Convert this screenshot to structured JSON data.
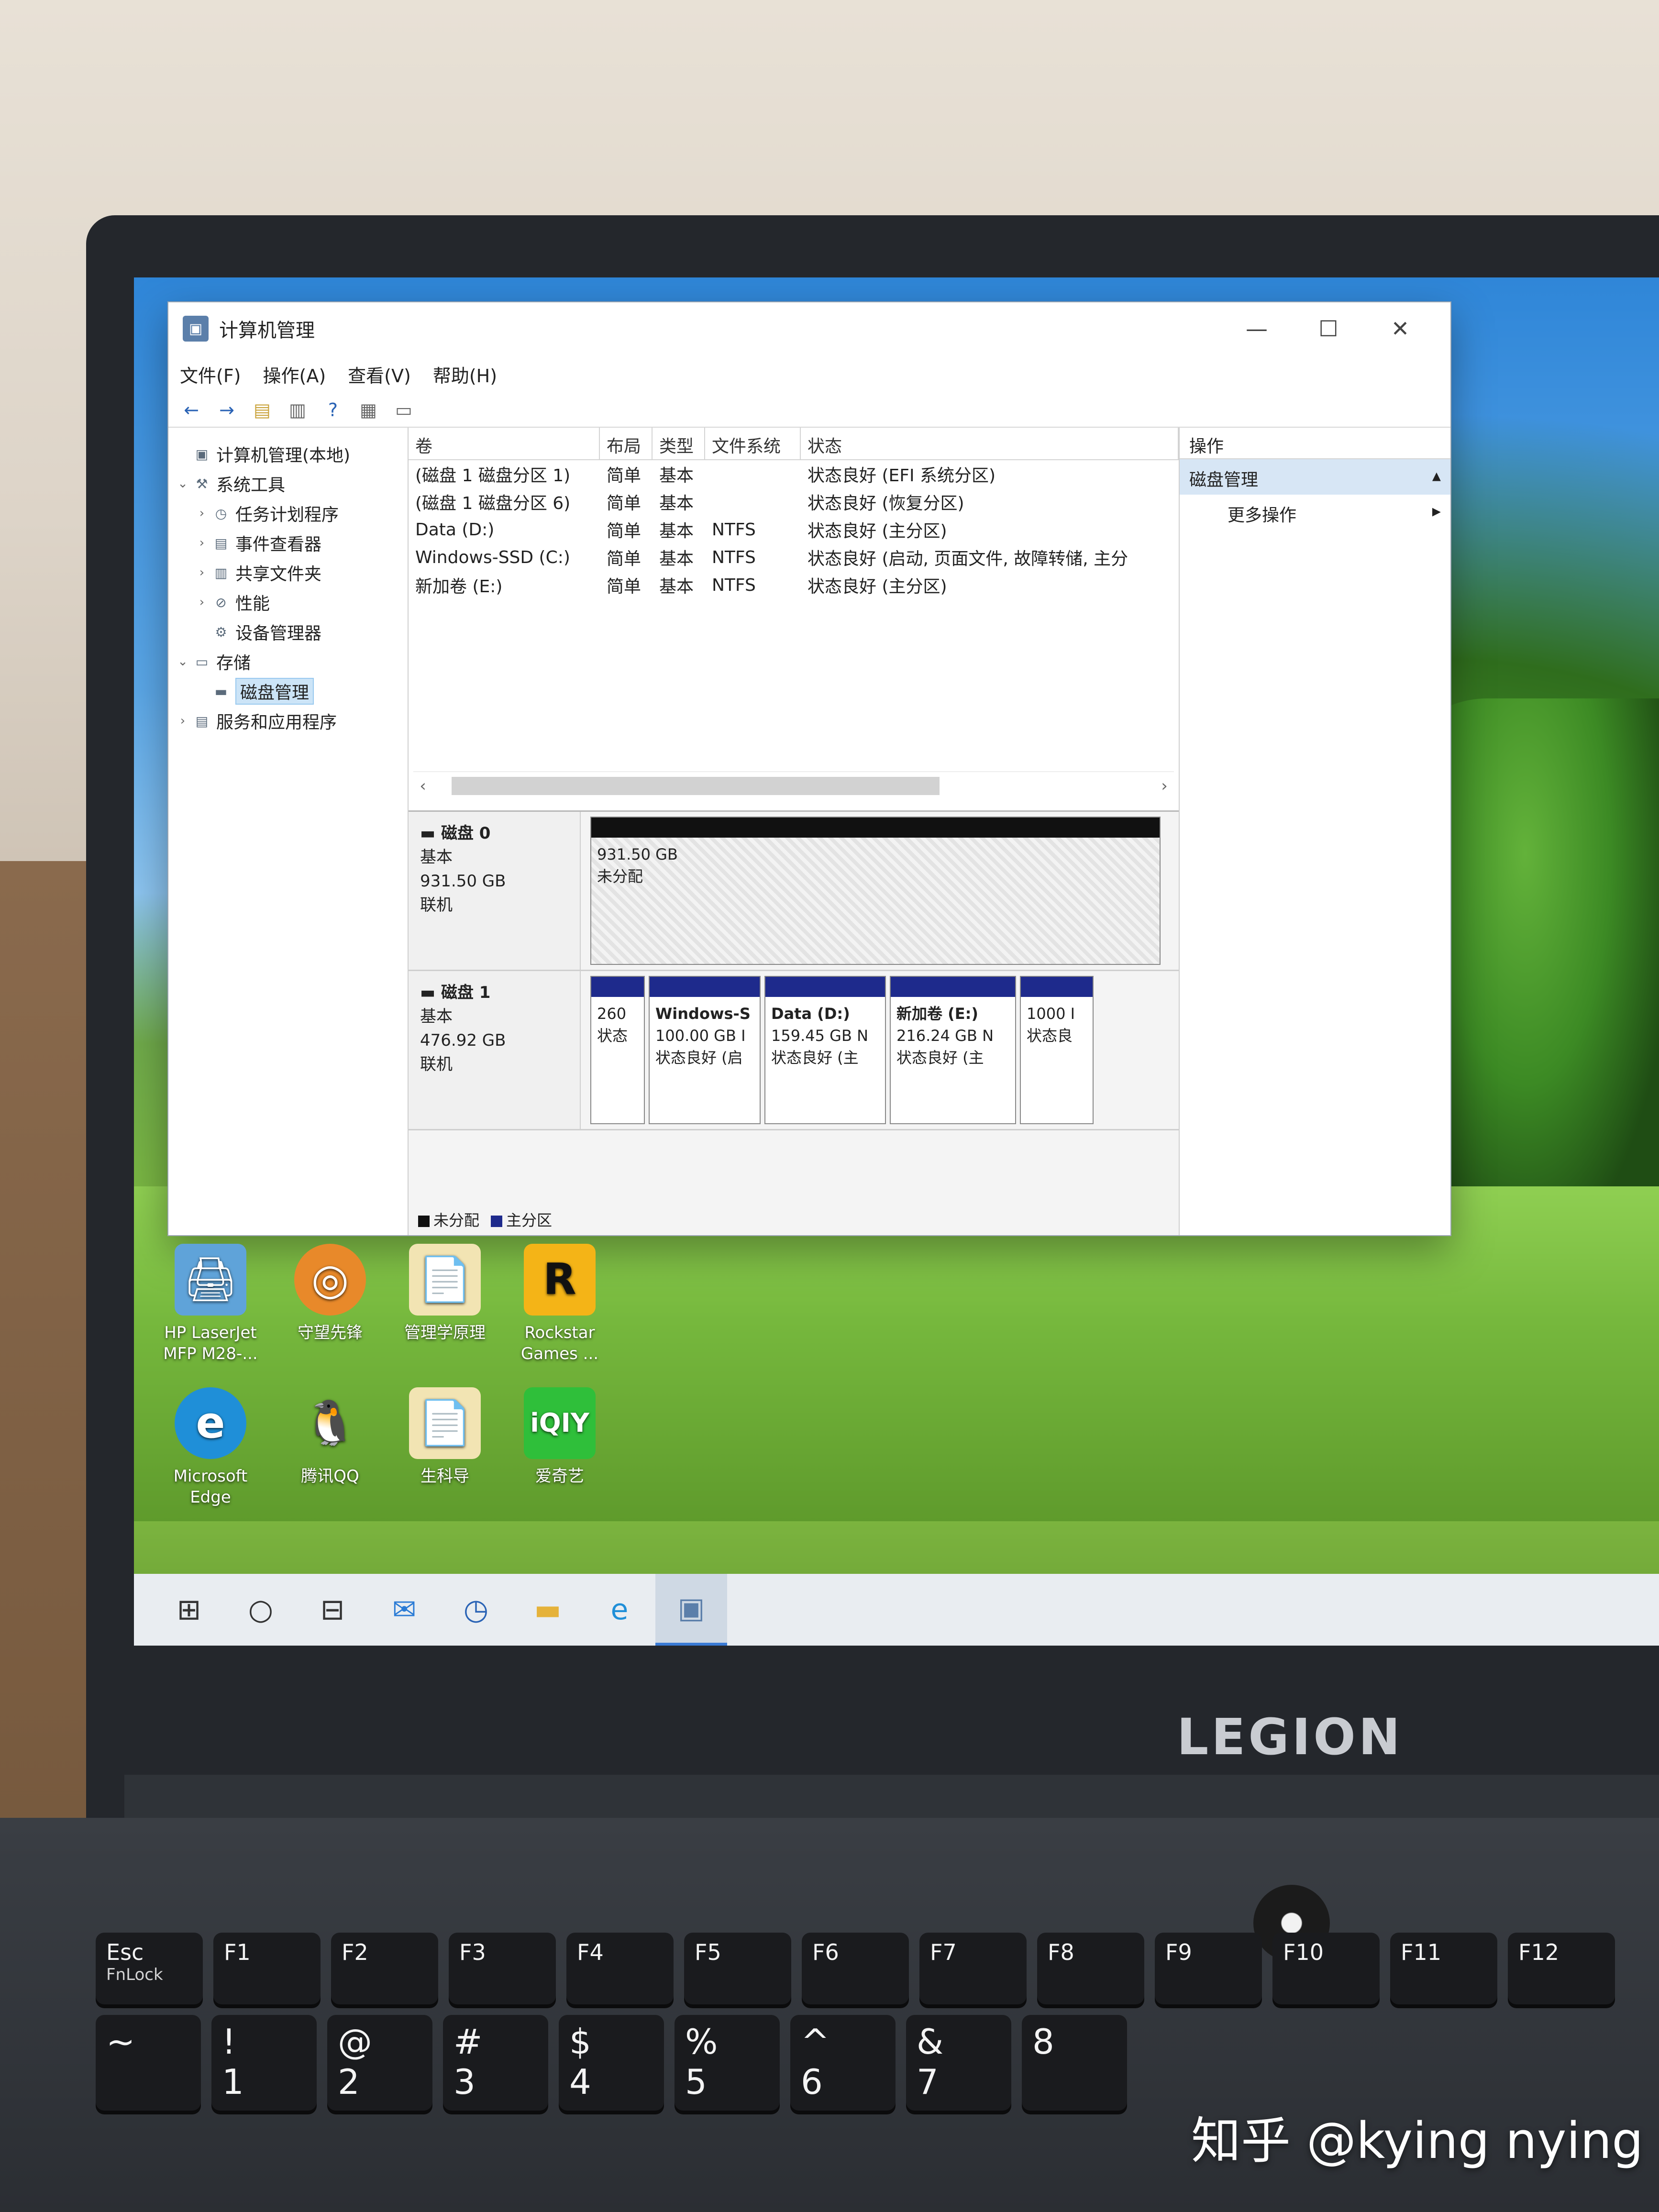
{
  "window": {
    "title": "计算机管理",
    "controls": {
      "minimize": "—",
      "maximize": "☐",
      "close": "✕"
    }
  },
  "menu": [
    "文件(F)",
    "操作(A)",
    "查看(V)",
    "帮助(H)"
  ],
  "tree": [
    {
      "label": "计算机管理(本地)",
      "level": 0,
      "expander": ""
    },
    {
      "label": "系统工具",
      "level": 1,
      "expander": "⌄"
    },
    {
      "label": "任务计划程序",
      "level": 2,
      "expander": "›"
    },
    {
      "label": "事件查看器",
      "level": 2,
      "expander": "›"
    },
    {
      "label": "共享文件夹",
      "level": 2,
      "expander": "›"
    },
    {
      "label": "性能",
      "level": 2,
      "expander": "›"
    },
    {
      "label": "设备管理器",
      "level": 2,
      "expander": ""
    },
    {
      "label": "存储",
      "level": 1,
      "expander": "⌄"
    },
    {
      "label": "磁盘管理",
      "level": 2,
      "expander": "",
      "selected": true
    },
    {
      "label": "服务和应用程序",
      "level": 1,
      "expander": "›"
    }
  ],
  "volume_table": {
    "headers": [
      "卷",
      "布局",
      "类型",
      "文件系统",
      "状态"
    ],
    "rows": [
      [
        "(磁盘 1 磁盘分区 1)",
        "简单",
        "基本",
        "",
        "状态良好 (EFI 系统分区)"
      ],
      [
        "(磁盘 1 磁盘分区 6)",
        "简单",
        "基本",
        "",
        "状态良好 (恢复分区)"
      ],
      [
        "Data (D:)",
        "简单",
        "基本",
        "NTFS",
        "状态良好 (主分区)"
      ],
      [
        "Windows-SSD (C:)",
        "简单",
        "基本",
        "NTFS",
        "状态良好 (启动, 页面文件, 故障转储, 主分"
      ],
      [
        "新加卷 (E:)",
        "简单",
        "基本",
        "NTFS",
        "状态良好 (主分区)"
      ]
    ]
  },
  "disks": [
    {
      "name": "磁盘 0",
      "type": "基本",
      "size": "931.50 GB",
      "status": "联机",
      "partitions": [
        {
          "name": "",
          "size": "931.50 GB",
          "status": "未分配",
          "kind": "unallocated"
        }
      ]
    },
    {
      "name": "磁盘 1",
      "type": "基本",
      "size": "476.92 GB",
      "status": "联机",
      "partitions": [
        {
          "name": "",
          "size": "260",
          "status": "状态",
          "kind": "primary"
        },
        {
          "name": "Windows-S",
          "size": "100.00 GB I",
          "status": "状态良好 (启",
          "kind": "primary"
        },
        {
          "name": "Data  (D:)",
          "size": "159.45 GB N",
          "status": "状态良好 (主",
          "kind": "primary"
        },
        {
          "name": "新加卷  (E:)",
          "size": "216.24 GB N",
          "status": "状态良好 (主",
          "kind": "primary"
        },
        {
          "name": "",
          "size": "1000 I",
          "status": "状态良",
          "kind": "primary"
        }
      ]
    }
  ],
  "legend": [
    "未分配",
    "主分区"
  ],
  "actions": {
    "header": "操作",
    "section": "磁盘管理",
    "more": "更多操作"
  },
  "desktop_icons": [
    {
      "label": "HP LaserJet MFP M28-...",
      "icon": "printer-icon",
      "glyph": "🖨"
    },
    {
      "label": "守望先锋",
      "icon": "overwatch-icon",
      "glyph": "◎"
    },
    {
      "label": "管理学原理",
      "icon": "document-icon",
      "glyph": "📄"
    },
    {
      "label": "Rockstar Games ...",
      "icon": "rockstar-icon",
      "glyph": "R"
    },
    {
      "label": "Microsoft Edge",
      "icon": "edge-icon",
      "glyph": "e"
    },
    {
      "label": "腾讯QQ",
      "icon": "qq-icon",
      "glyph": "🐧"
    },
    {
      "label": "生科导",
      "icon": "document-icon",
      "glyph": "📄"
    },
    {
      "label": "爱奇艺",
      "icon": "iqiyi-icon",
      "glyph": "iQIY"
    }
  ],
  "brand": "LEGION",
  "watermark": "知乎 @kying nying",
  "keyboard": {
    "fn_row": [
      "Esc",
      "F1",
      "F2",
      "F3",
      "F4",
      "F5",
      "F6",
      "F7",
      "F8",
      "F9",
      "F10",
      "F11",
      "F12"
    ],
    "esc_sub": "FnLock",
    "num_row": [
      {
        "top": "~",
        "bottom": ""
      },
      {
        "top": "!",
        "bottom": "1"
      },
      {
        "top": "@",
        "bottom": "2"
      },
      {
        "top": "#",
        "bottom": "3"
      },
      {
        "top": "$",
        "bottom": "4"
      },
      {
        "top": "%",
        "bottom": "5"
      },
      {
        "top": "^",
        "bottom": "6"
      },
      {
        "top": "&",
        "bottom": "7"
      },
      {
        "top": "",
        "bottom": "8"
      }
    ]
  },
  "colors": {
    "primary_partition": "#1e2a8c",
    "unallocated": "#111111",
    "selection": "#cce4f7"
  }
}
